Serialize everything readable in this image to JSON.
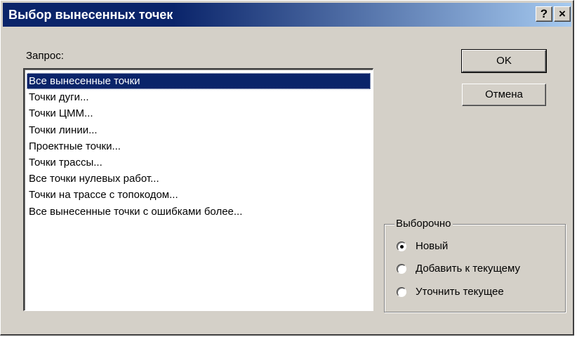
{
  "window": {
    "title": "Выбор вынесенных точек",
    "help_label": "?",
    "close_label": "×"
  },
  "query": {
    "label": "Запрос:",
    "items": [
      {
        "label": "Все вынесенные точки",
        "selected": true
      },
      {
        "label": "Точки дуги...",
        "selected": false
      },
      {
        "label": "Точки ЦММ...",
        "selected": false
      },
      {
        "label": "Точки линии...",
        "selected": false
      },
      {
        "label": "Проектные точки...",
        "selected": false
      },
      {
        "label": "Точки трассы...",
        "selected": false
      },
      {
        "label": "Все точки нулевых работ...",
        "selected": false
      },
      {
        "label": "Точки на трассе с топокодом...",
        "selected": false
      },
      {
        "label": "Все вынесенные точки с ошибками более...",
        "selected": false
      }
    ]
  },
  "buttons": {
    "ok_label": "OK",
    "cancel_label": "Отмена"
  },
  "selection": {
    "group_label": "Выборочно",
    "options": [
      {
        "label": "Новый",
        "checked": true
      },
      {
        "label": "Добавить к текущему",
        "checked": false
      },
      {
        "label": "Уточнить текущее",
        "checked": false
      }
    ]
  },
  "colors": {
    "face": "#d4d0c8",
    "title_start": "#0a246a",
    "title_end": "#a6caf0",
    "selection": "#0a246a"
  }
}
